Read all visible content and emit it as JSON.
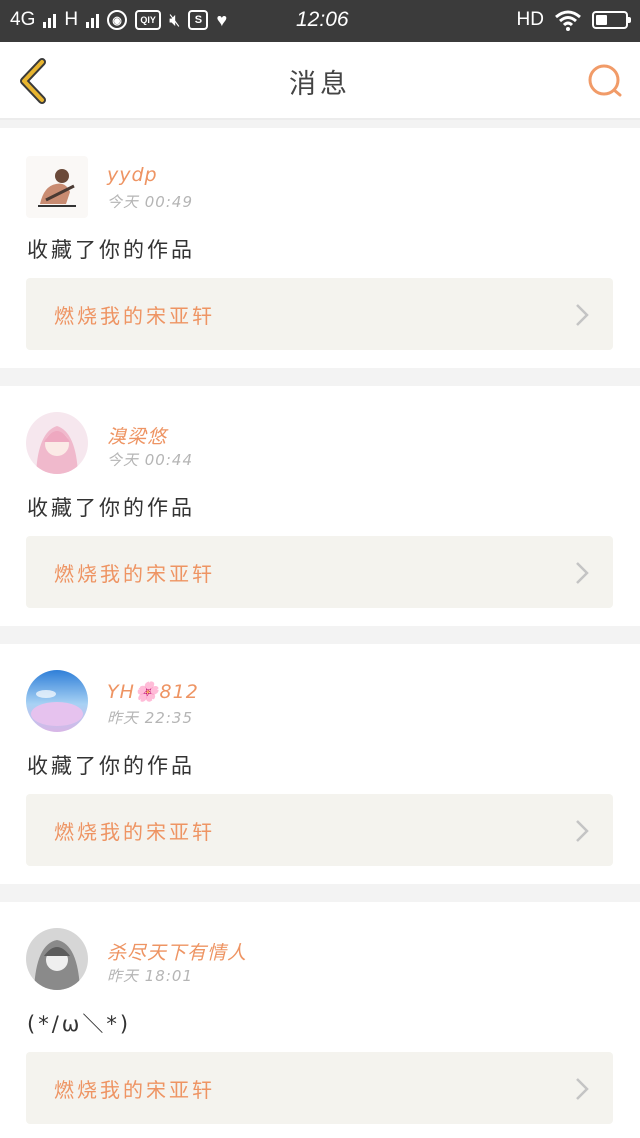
{
  "status_bar": {
    "network1": "4G",
    "network2": "H",
    "qiyi": "QIY",
    "s_badge": "S",
    "time": "12:06",
    "hd": "HD",
    "battery_level": 0.4
  },
  "nav": {
    "title": "消息",
    "back_icon": "chevron-left-icon",
    "search_icon": "search-icon"
  },
  "colors": {
    "accent": "#ee9463",
    "back_icon": "#e8b530",
    "card_bg": "#ffffff",
    "work_bg": "#f4f3ee"
  },
  "messages": [
    {
      "username": "yydp",
      "time": "今天 00:49",
      "action": "收藏了你的作品",
      "work_title": "燃烧我的宋亚轩"
    },
    {
      "username": "溴梁悠",
      "time": "今天 00:44",
      "action": "收藏了你的作品",
      "work_title": "燃烧我的宋亚轩"
    },
    {
      "username": "YH🌸812",
      "time": "昨天 22:35",
      "action": "收藏了你的作品",
      "work_title": "燃烧我的宋亚轩"
    },
    {
      "username": "杀尽天下有情人",
      "time": "昨天 18:01",
      "action": "(*/ω＼*)",
      "work_title": "燃烧我的宋亚轩"
    }
  ]
}
